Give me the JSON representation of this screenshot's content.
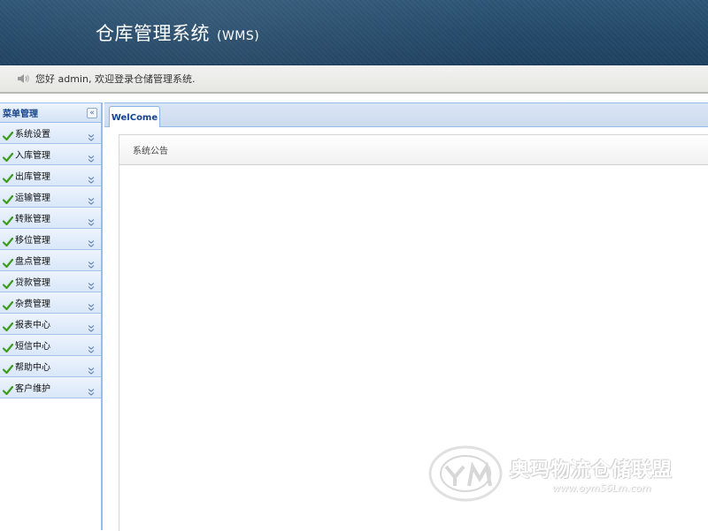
{
  "header": {
    "title": "仓库管理系统",
    "subtitle": "(WMS)",
    "background_color": "#244a6a"
  },
  "greeting": {
    "icon": "speaker-icon",
    "text": "您好 admin, 欢迎登录仓储管理系统."
  },
  "sidebar": {
    "title": "菜单管理",
    "collapse_icon": "double-chevron-left-icon",
    "items": [
      {
        "label": "系统设置",
        "icon": "check-icon"
      },
      {
        "label": "入库管理",
        "icon": "check-icon"
      },
      {
        "label": "出库管理",
        "icon": "check-icon"
      },
      {
        "label": "运输管理",
        "icon": "check-icon"
      },
      {
        "label": "转账管理",
        "icon": "check-icon"
      },
      {
        "label": "移位管理",
        "icon": "check-icon"
      },
      {
        "label": "盘点管理",
        "icon": "check-icon"
      },
      {
        "label": "贷款管理",
        "icon": "check-icon"
      },
      {
        "label": "杂费管理",
        "icon": "check-icon"
      },
      {
        "label": "报表中心",
        "icon": "check-icon"
      },
      {
        "label": "短信中心",
        "icon": "check-icon"
      },
      {
        "label": "帮助中心",
        "icon": "check-icon"
      },
      {
        "label": "客户维护",
        "icon": "check-icon"
      }
    ]
  },
  "main": {
    "tabs": [
      {
        "label": "WelCome",
        "active": true
      }
    ],
    "panel": {
      "title": "系统公告"
    }
  },
  "watermark": {
    "title": "奥玛物流仓储联盟",
    "url": "www.oym56Lm.com"
  },
  "colors": {
    "accent": "#15428b",
    "sidebar_border": "#99bbe8",
    "check_green": "#3d9a1e"
  }
}
